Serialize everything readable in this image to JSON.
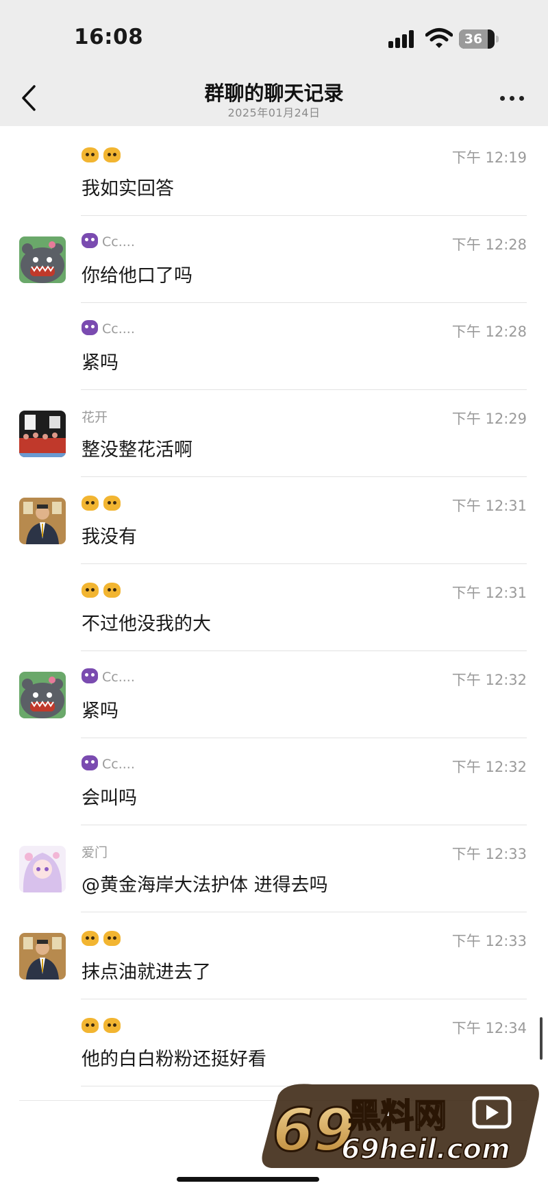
{
  "status_bar": {
    "time": "16:08",
    "battery": "36"
  },
  "nav": {
    "title": "群聊的聊天记录",
    "subtitle": "2025年01月24日"
  },
  "messages": [
    {
      "sender": "",
      "emoji": "tiger",
      "time": "下午 12:19",
      "text": "我如实回答",
      "avatar": "none"
    },
    {
      "sender": "Cc....",
      "emoji": "purple",
      "time": "下午 12:28",
      "text": "你给他口了吗",
      "avatar": "gray-monster"
    },
    {
      "sender": "Cc....",
      "emoji": "purple",
      "time": "下午 12:28",
      "text": "紧吗",
      "avatar": "none"
    },
    {
      "sender": "花开",
      "emoji": "",
      "time": "下午 12:29",
      "text": "整没整花活啊",
      "avatar": "crowd-photo"
    },
    {
      "sender": "",
      "emoji": "tiger",
      "time": "下午 12:31",
      "text": "我没有",
      "avatar": "man-in-suit"
    },
    {
      "sender": "",
      "emoji": "tiger",
      "time": "下午 12:31",
      "text": "不过他没我的大",
      "avatar": "none"
    },
    {
      "sender": "Cc....",
      "emoji": "purple",
      "time": "下午 12:32",
      "text": "紧吗",
      "avatar": "gray-monster"
    },
    {
      "sender": "Cc....",
      "emoji": "purple",
      "time": "下午 12:32",
      "text": "会叫吗",
      "avatar": "none"
    },
    {
      "sender": "爱门",
      "emoji": "",
      "time": "下午 12:33",
      "text": "@黄金海岸大法护体 进得去吗",
      "avatar": "anime-girl"
    },
    {
      "sender": "",
      "emoji": "tiger",
      "time": "下午 12:33",
      "text": "抹点油就进去了",
      "avatar": "man-in-suit"
    },
    {
      "sender": "",
      "emoji": "tiger",
      "time": "下午 12:34",
      "text": "他的白白粉粉还挺好看",
      "avatar": "none"
    }
  ],
  "watermark": {
    "brand": "69黑料网",
    "url": "69heil.com"
  },
  "colors": {
    "topbar": "#ededed",
    "text": "#191919",
    "meta": "#9a9a9a",
    "separator": "#e2e2e2"
  }
}
